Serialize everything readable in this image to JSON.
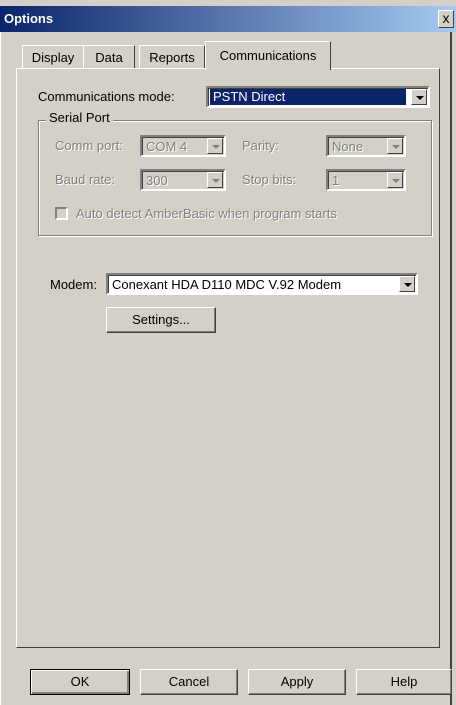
{
  "window": {
    "title": "Options",
    "close_glyph": "x"
  },
  "tabs": [
    {
      "label": "Display"
    },
    {
      "label": "Data"
    },
    {
      "label": "Reports"
    },
    {
      "label": "Communications",
      "active": true
    }
  ],
  "communications_mode": {
    "label": "Communications mode:",
    "value": "PSTN Direct"
  },
  "serial_port": {
    "title": "Serial Port",
    "comm_port": {
      "label": "Comm port:",
      "value": "COM 4"
    },
    "parity": {
      "label": "Parity:",
      "value": "None"
    },
    "baud_rate": {
      "label": "Baud rate:",
      "value": "300"
    },
    "stop_bits": {
      "label": "Stop bits:",
      "value": "1"
    },
    "auto_detect": {
      "label": "Auto detect AmberBasic when program starts",
      "checked": false,
      "enabled": false
    }
  },
  "modem": {
    "label": "Modem:",
    "value": "Conexant HDA D110 MDC V.92 Modem",
    "settings_label": "Settings..."
  },
  "buttons": {
    "ok": "OK",
    "cancel": "Cancel",
    "apply": "Apply",
    "help": "Help"
  },
  "colors": {
    "title_bar_start": "#0a246a",
    "title_bar_end": "#a6caf0",
    "face": "#d4d0c8",
    "selection": "#0a246a"
  }
}
